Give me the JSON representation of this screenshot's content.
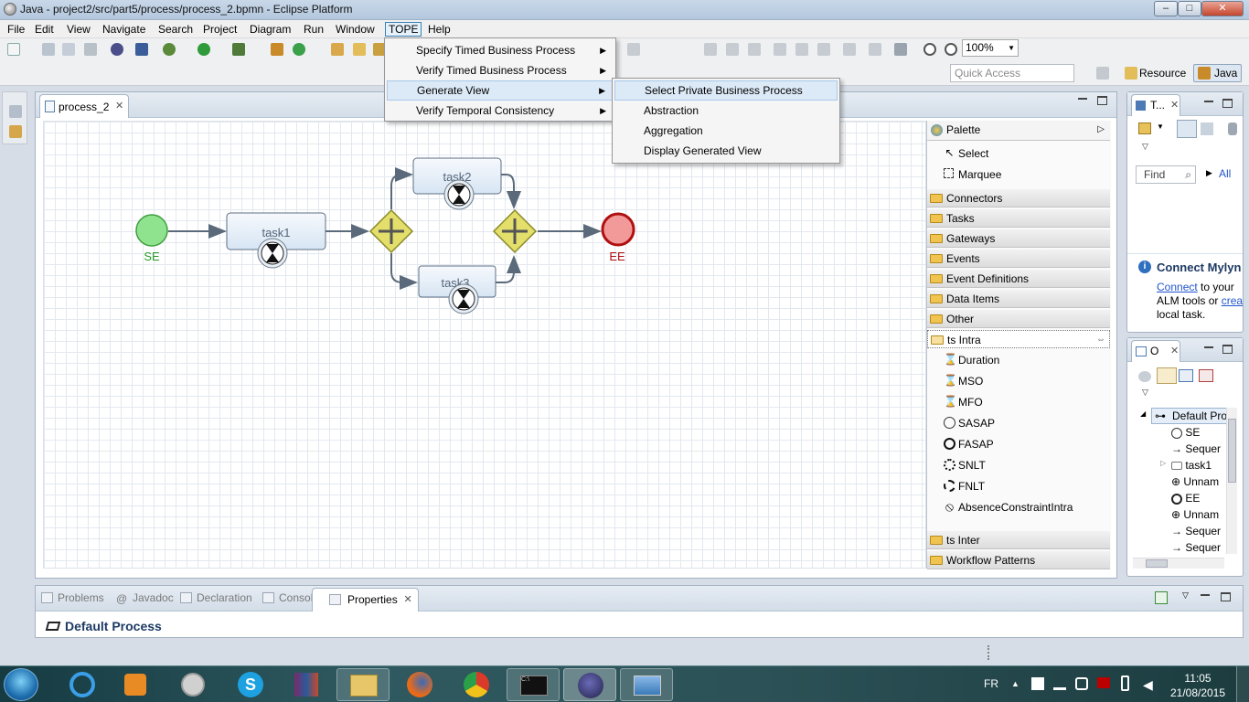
{
  "window": {
    "title": "Java - project2/src/part5/process/process_2.bpmn - Eclipse Platform",
    "min": "–",
    "max": "□",
    "close": "✕"
  },
  "menubar": [
    "File",
    "Edit",
    "View",
    "Navigate",
    "Search",
    "Project",
    "Diagram",
    "Run",
    "Window",
    "TOPE",
    "Help"
  ],
  "toolbar": {
    "zoom": "100%",
    "quick_access_placeholder": "Quick Access",
    "perspectives": [
      "Resource",
      "Java"
    ]
  },
  "editor": {
    "tab_label": "process_2",
    "diagram": {
      "start_event": "SE",
      "end_event": "EE",
      "tasks": [
        "task1",
        "task2",
        "task3"
      ]
    }
  },
  "palette": {
    "title": "Palette",
    "tools": [
      "Select",
      "Marquee"
    ],
    "drawers": [
      "Connectors",
      "Tasks",
      "Gateways",
      "Events",
      "Event Definitions",
      "Data Items",
      "Other",
      "ts Intra"
    ],
    "ts_intra_items": [
      "Duration",
      "MSO",
      "MFO",
      "SASAP",
      "FASAP",
      "SNLT",
      "FNLT",
      "AbsenceConstraintIntra"
    ],
    "bottom_drawers": [
      "ts Inter",
      "Workflow Patterns"
    ]
  },
  "task_list": {
    "tab": "T...",
    "find_placeholder": "Find",
    "all": "All",
    "mylyn_title": "Connect Mylyn",
    "mylyn_link1": "Connect",
    "mylyn_text1": " to your",
    "mylyn_text2": "ALM tools or ",
    "mylyn_link2": "crea",
    "mylyn_text3": "local task."
  },
  "outline": {
    "tab": "O",
    "root": "Default Pro",
    "items": [
      "SE",
      "Sequer",
      "task1",
      "Unnam",
      "EE",
      "Unnam",
      "Sequer",
      "Sequer"
    ]
  },
  "bottom": {
    "tabs": [
      "Problems",
      "Javadoc",
      "Declaration",
      "Console",
      "Properties"
    ],
    "title": "Default Process"
  },
  "tope_menu": [
    "Specify Timed Business Process",
    "Verify Timed Business Process",
    "Generate View",
    "Verify Temporal Consistency"
  ],
  "generate_view_submenu": [
    "Select Private Business Process",
    "Abstraction",
    "Aggregation",
    "Display Generated View"
  ],
  "taskbar": {
    "lang": "FR",
    "time": "11:05",
    "date": "21/08/2015"
  }
}
